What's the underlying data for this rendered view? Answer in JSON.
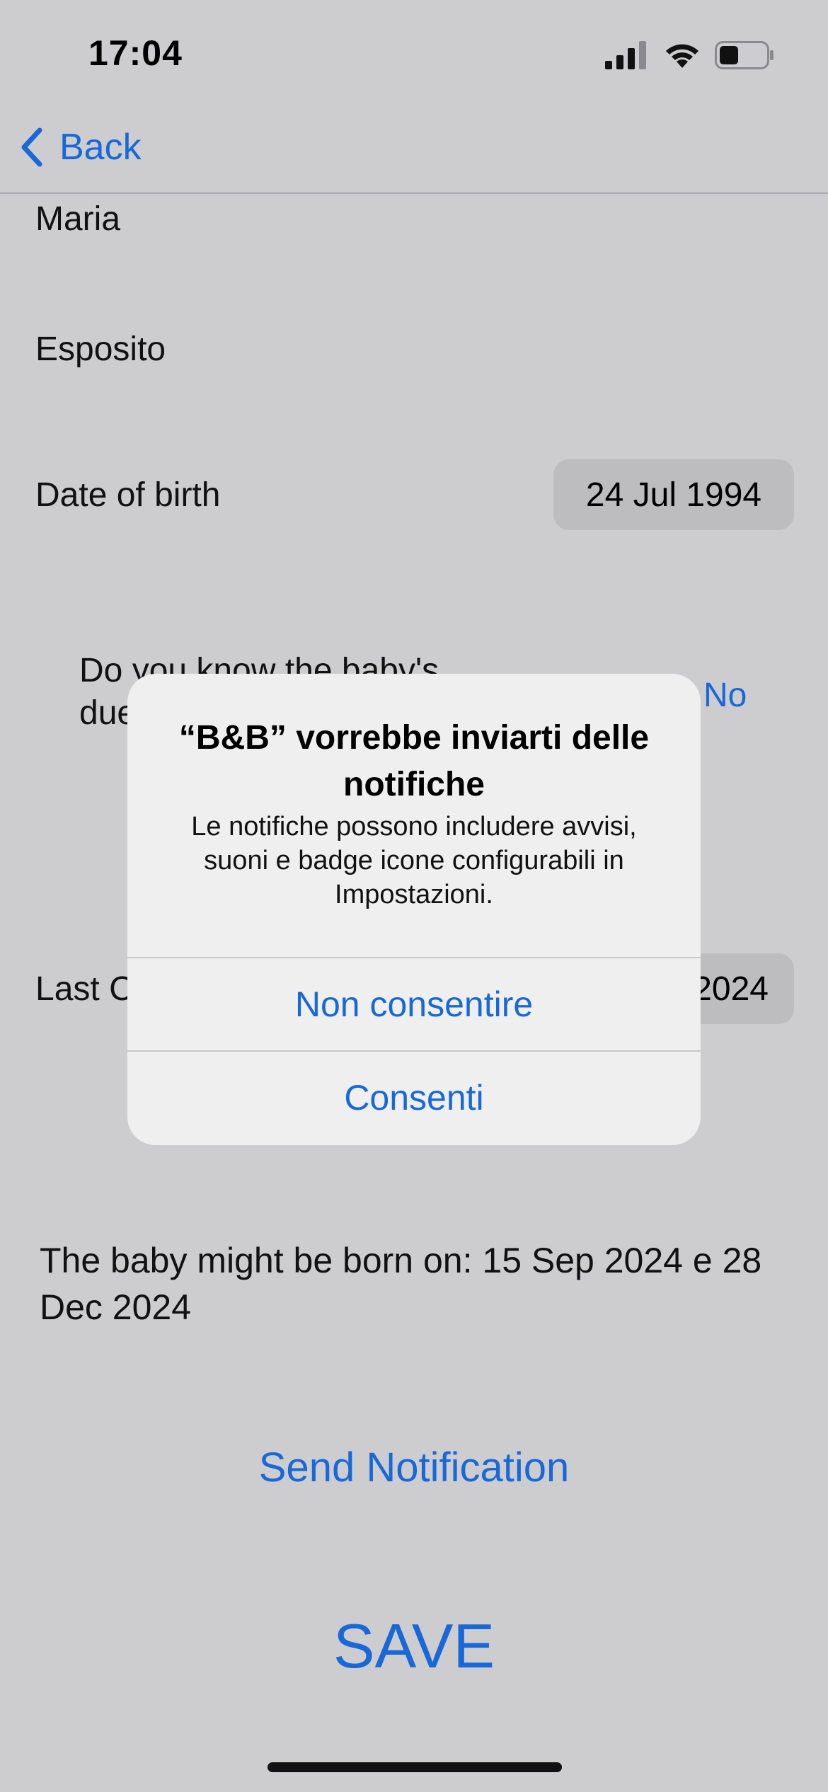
{
  "status_bar": {
    "time": "17:04"
  },
  "nav": {
    "back_label": "Back"
  },
  "form": {
    "first_name": "Maria",
    "last_name": "Esposito",
    "dob_label": "Date of birth",
    "dob_value": "24 Jul 1994",
    "due_date_question": "Do you know the baby's due",
    "due_date_answer": "No",
    "last_cycle_label": "Last C",
    "last_cycle_value_partial": "2024",
    "prediction": "The baby might be born on: 15 Sep 2024 e 28 Dec 2024",
    "send_notification_label": "Send Notification",
    "save_label": "SAVE"
  },
  "alert": {
    "title": "“B&B” vorrebbe inviarti delle notifiche",
    "message": "Le notifiche possono includere avvisi, suoni e badge icone configurabili in Impostazioni.",
    "deny_label": "Non consentire",
    "allow_label": "Consenti"
  },
  "colors": {
    "accent": "#1868d8",
    "background": "#cdcdcf",
    "alert_bg": "#efefef"
  }
}
